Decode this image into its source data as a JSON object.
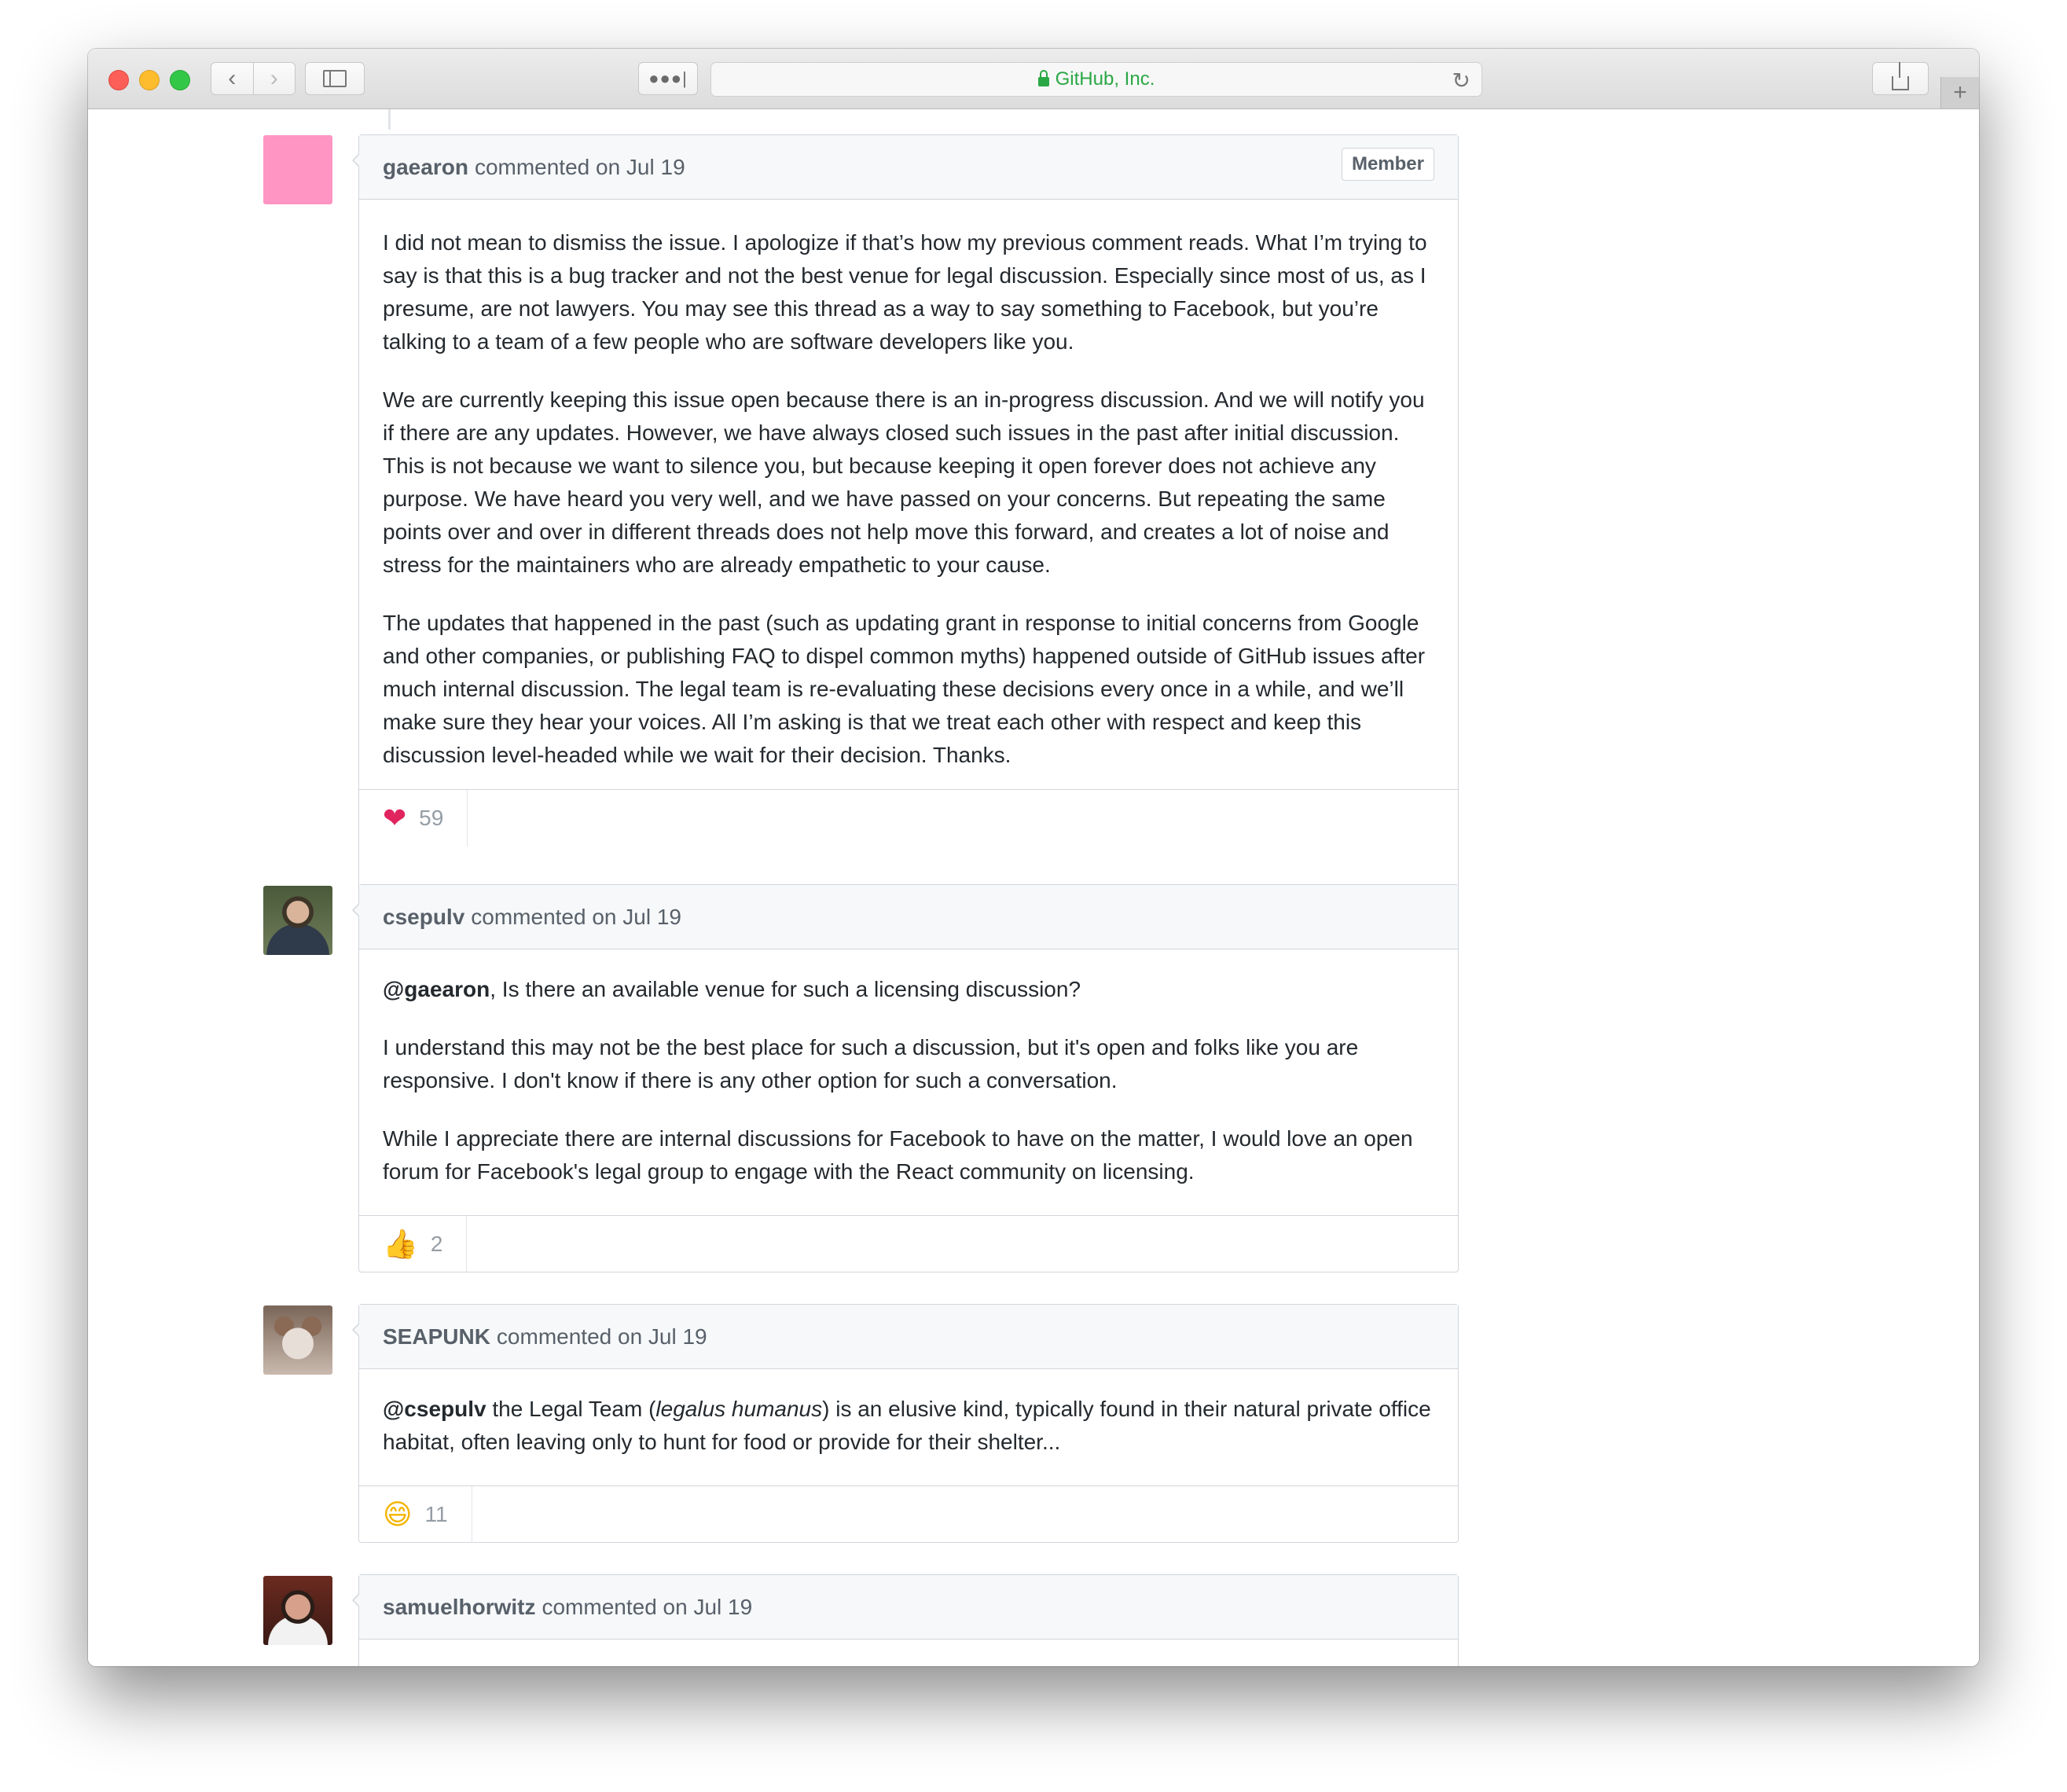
{
  "browser": {
    "address": "GitHub, Inc."
  },
  "comments": [
    {
      "author": "gaearon",
      "meta": "commented on Jul 19",
      "badge": "Member",
      "paragraphs": [
        "I did not mean to dismiss the issue. I apologize if that’s how my previous comment reads. What I’m trying to say is that this is a bug tracker and not the best venue for legal discussion. Especially since most of us, as I presume, are not lawyers. You may see this thread as a way to say something to Facebook, but you’re talking to a team of a few people who are software developers like you.",
        "We are currently keeping this issue open because there is an in-progress discussion. And we will notify you if there are any updates. However, we have always closed such issues in the past after initial discussion. This is not because we want to silence you, but because keeping it open forever does not achieve any purpose. We have heard you very well, and we have passed on your concerns. But repeating the same points over and over in different threads does not help move this forward, and creates a lot of noise and stress for the maintainers who are already empathetic to your cause.",
        "The updates that happened in the past (such as updating grant in response to initial concerns from Google and other companies, or publishing FAQ to dispel common myths) happened outside of GitHub issues after much internal discussion. The legal team is re-evaluating these decisions every once in a while, and we’ll make sure they hear your voices. All I’m asking is that we treat each other with respect and keep this discussion level-headed while we wait for their decision. Thanks."
      ],
      "reaction": {
        "icon": "heart-emoji",
        "count": "59"
      }
    },
    {
      "author": "csepulv",
      "meta": "commented on Jul 19",
      "mention": "@gaearon",
      "first_rest": ", Is there an available venue for such a licensing discussion?",
      "paragraphs": [
        "I understand this may not be the best place for such a discussion, but it's open and folks like you are responsive. I don't know if there is any other option for such a conversation.",
        "While I appreciate there are internal discussions for Facebook to have on the matter, I would love an open forum for Facebook's legal group to engage with the React community on licensing."
      ],
      "reaction": {
        "icon": "thumbs-up-emoji",
        "count": "2"
      }
    },
    {
      "author": "SEAPUNK",
      "meta": "commented on Jul 19",
      "mention": "@csepulv",
      "text_a": " the Legal Team (",
      "italic": "legalus humanus",
      "text_b": ") is an elusive kind, typically found in their natural private office habitat, often leaving only to hunt for food or provide for their shelter...",
      "reaction": {
        "icon": "grinning-emoji",
        "count": "11"
      }
    },
    {
      "author": "samuelhorwitz",
      "meta": "commented on Jul 19"
    }
  ]
}
